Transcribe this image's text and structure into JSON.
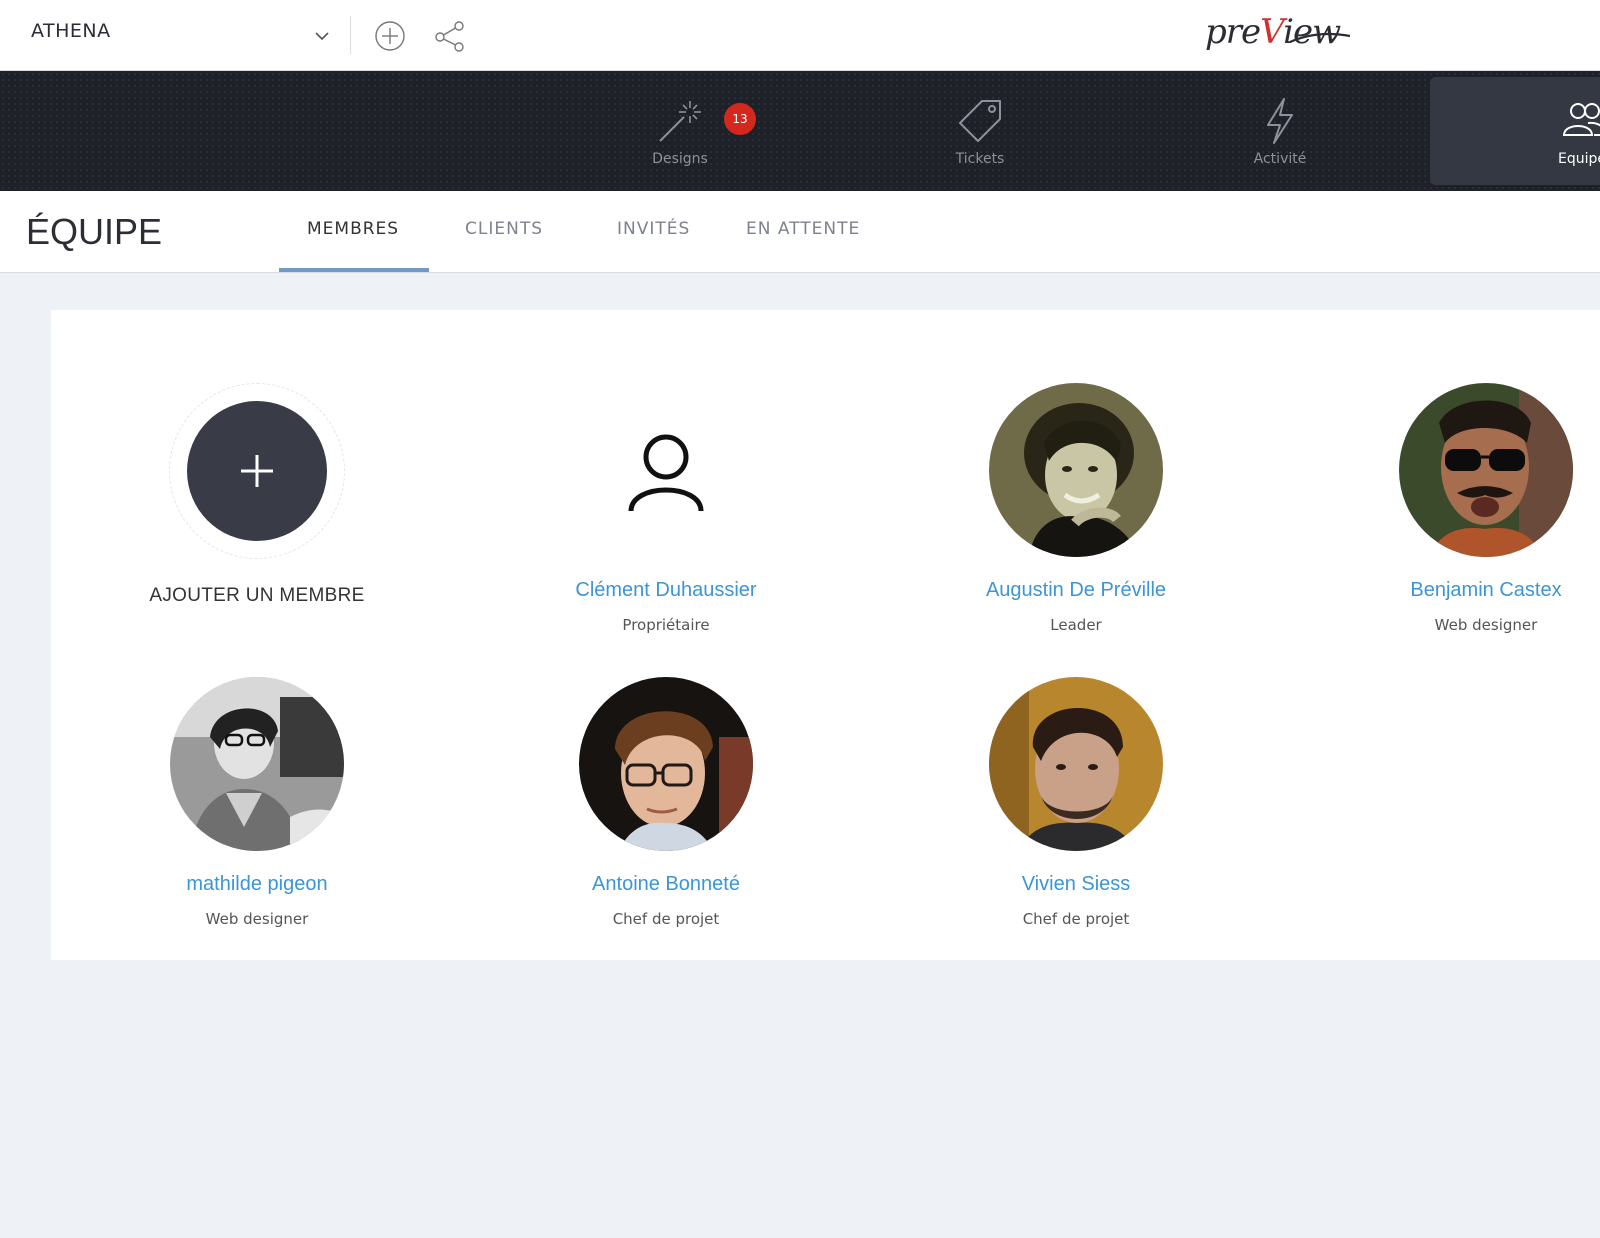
{
  "topbar": {
    "project_name": "ATHENA",
    "logo_text_start": "pre",
    "logo_text_accent": "V",
    "logo_text_end": "iew"
  },
  "nav": {
    "items": [
      {
        "label": "Designs",
        "icon": "magic-wand-icon",
        "badge": "13"
      },
      {
        "label": "Tickets",
        "icon": "tag-icon"
      },
      {
        "label": "Activité",
        "icon": "lightning-icon"
      },
      {
        "label": "Equipe",
        "icon": "team-icon",
        "active": true
      }
    ]
  },
  "page": {
    "title": "ÉQUIPE",
    "tabs": [
      {
        "label": "MEMBRES",
        "active": true
      },
      {
        "label": "CLIENTS"
      },
      {
        "label": "INVITÉS"
      },
      {
        "label": "EN ATTENTE"
      }
    ]
  },
  "add_member": {
    "label": "AJOUTER UN MEMBRE"
  },
  "members": [
    {
      "name": "Clément Duhaussier",
      "role": "Propriétaire"
    },
    {
      "name": "Augustin De Préville",
      "role": "Leader"
    },
    {
      "name": "Benjamin Castex",
      "role": "Web designer"
    },
    {
      "name": "mathilde pigeon",
      "role": "Web designer"
    },
    {
      "name": "Antoine Bonneté",
      "role": "Chef de projet"
    },
    {
      "name": "Vivien Siess",
      "role": "Chef de projet"
    }
  ],
  "colors": {
    "accent_link": "#3b95d6",
    "badge": "#d4271d",
    "nav_bg": "#1e2128",
    "tab_underline": "#6f99c9"
  }
}
